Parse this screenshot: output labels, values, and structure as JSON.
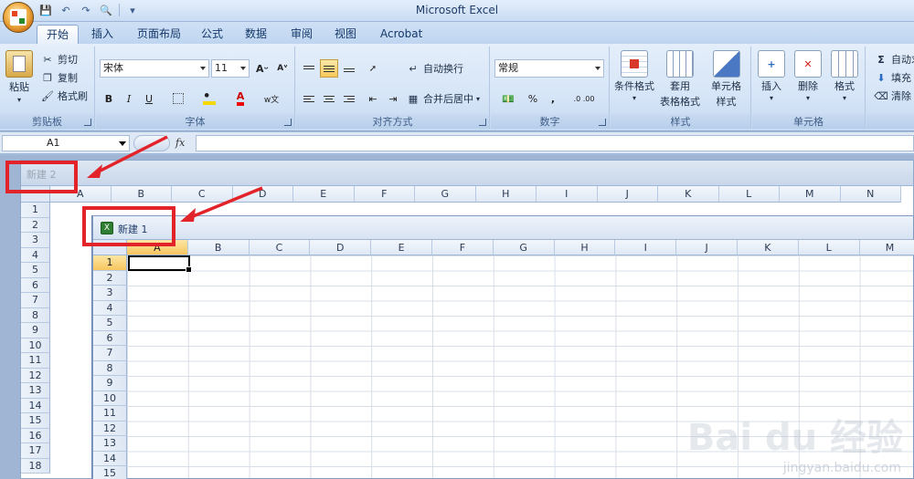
{
  "window": {
    "title": "Microsoft Excel"
  },
  "tabs": [
    "开始",
    "插入",
    "页面布局",
    "公式",
    "数据",
    "审阅",
    "视图",
    "Acrobat"
  ],
  "ribbon": {
    "clipboard": {
      "paste": "粘贴",
      "cut": "剪切",
      "copy": "复制",
      "format_painter": "格式刷",
      "label": "剪贴板"
    },
    "font": {
      "name": "宋体",
      "size": "11",
      "bold": "B",
      "italic": "I",
      "underline": "U",
      "label": "字体"
    },
    "alignment": {
      "wrap_text": "自动换行",
      "merge_center": "合并后居中",
      "label": "对齐方式"
    },
    "number": {
      "format": "常规",
      "percent": "%",
      "comma": ",",
      "inc_dec": ".0 .00",
      "label": "数字"
    },
    "styles": {
      "conditional": "条件格式",
      "table_format_1": "套用",
      "table_format_2": "表格格式",
      "cell_styles_1": "单元格",
      "cell_styles_2": "样式",
      "label": "样式"
    },
    "cells": {
      "insert": "插入",
      "delete": "删除",
      "format": "格式",
      "label": "单元格"
    },
    "editing": {
      "autosum": "自动求",
      "fill": "填充",
      "clear": "清除"
    }
  },
  "formula_bar": {
    "name_box": "A1",
    "fx": "fx"
  },
  "workbook_back": {
    "title": "新建 2",
    "columns": [
      "A",
      "B",
      "C",
      "D",
      "E",
      "F",
      "G",
      "H",
      "I",
      "J",
      "K",
      "L",
      "M",
      "N"
    ],
    "rows": [
      "1",
      "2",
      "3",
      "4",
      "5",
      "6",
      "7",
      "8",
      "9",
      "10",
      "11",
      "12",
      "13",
      "14",
      "15",
      "16",
      "17",
      "18"
    ]
  },
  "workbook_front": {
    "title": "新建 1",
    "columns": [
      "A",
      "B",
      "C",
      "D",
      "E",
      "F",
      "G",
      "H",
      "I",
      "J",
      "K",
      "L",
      "M"
    ],
    "rows": [
      "1",
      "2",
      "3",
      "4",
      "5",
      "6",
      "7",
      "8",
      "9",
      "10",
      "11",
      "12",
      "13",
      "14",
      "15"
    ]
  },
  "watermark": {
    "brand": "Bai du 经验",
    "url": "jingyan.baidu.com"
  },
  "colors": {
    "annotation_red": "#e2232a",
    "selection_gold": "#f7c660",
    "ribbon_blue": "#d6e5f7"
  }
}
